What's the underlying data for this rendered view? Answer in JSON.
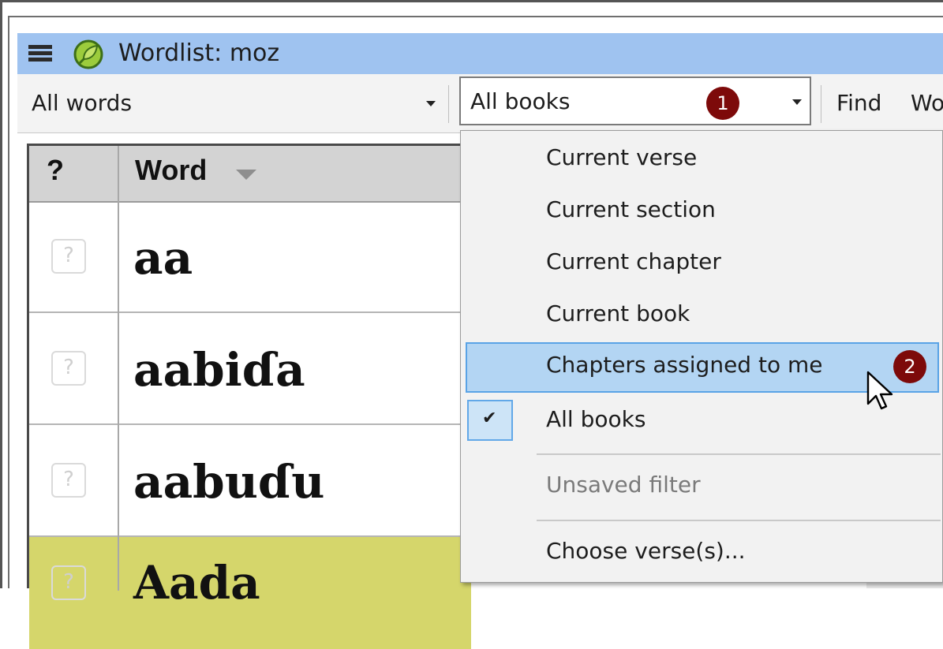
{
  "window": {
    "title": "Wordlist: moz"
  },
  "toolbar": {
    "filter_value": "All words",
    "scope_value": "All books",
    "find_label": "Find",
    "next_label_partial": "Wo"
  },
  "callouts": {
    "first": "1",
    "second": "2"
  },
  "table": {
    "columns": [
      "?",
      "Word"
    ],
    "rows": [
      {
        "status": "?",
        "word": "aa"
      },
      {
        "status": "?",
        "word": "aabiɗa"
      },
      {
        "status": "?",
        "word": "aabuɗu"
      },
      {
        "status": "?",
        "word": "Aada"
      }
    ]
  },
  "menu": {
    "items": [
      {
        "label": "Current verse"
      },
      {
        "label": "Current section"
      },
      {
        "label": "Current chapter"
      },
      {
        "label": "Current book"
      },
      {
        "label": "Chapters assigned to me",
        "state": "hover"
      },
      {
        "label": "All books",
        "checked": true,
        "check_glyph": "✔"
      },
      {
        "label": "Unsaved filter",
        "disabled": true
      },
      {
        "label": "Choose verse(s)..."
      }
    ]
  },
  "colors": {
    "titlebar": "#9fc3f0",
    "callout": "#7d0a0a",
    "row_highlight": "#d5d66b",
    "menu_hover": "#b3d5f3"
  },
  "icons": [
    "hamburger-menu-icon",
    "app-logo-icon",
    "dropdown-arrow-icon",
    "sort-descending-icon",
    "question-mark-icon",
    "checkmark-icon",
    "mouse-pointer-icon"
  ]
}
